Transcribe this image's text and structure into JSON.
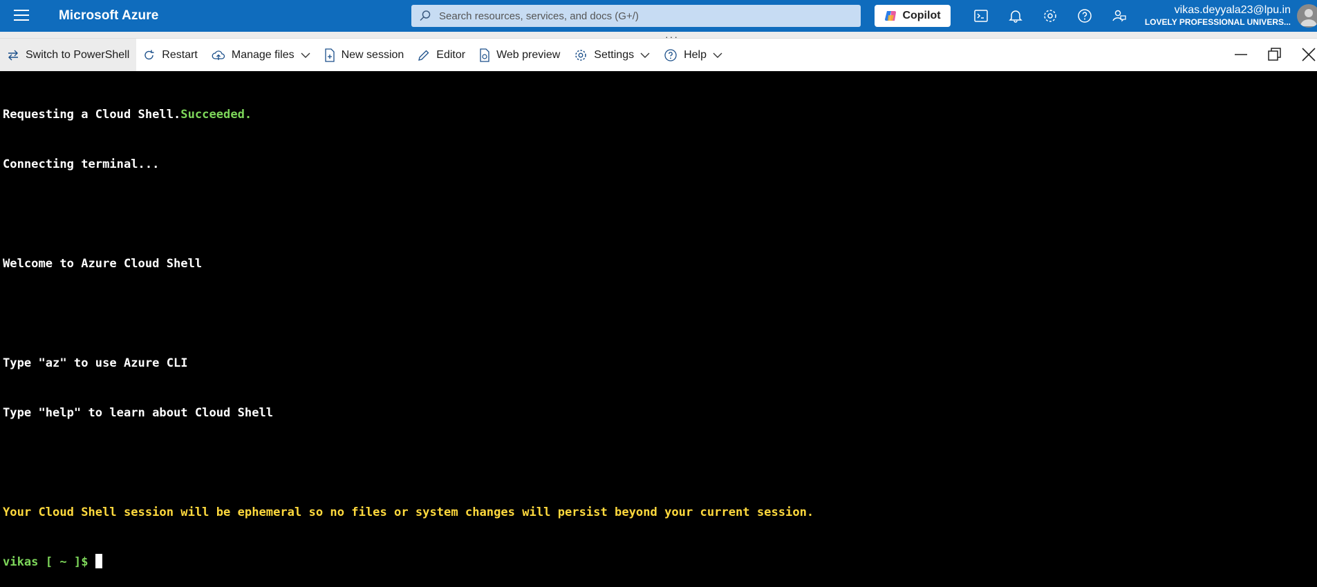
{
  "topbar": {
    "brand": "Microsoft Azure",
    "search_placeholder": "Search resources, services, and docs (G+/)",
    "copilot_label": "Copilot",
    "user_email": "vikas.deyyala23@lpu.in",
    "user_org": "LOVELY PROFESSIONAL UNIVERS..."
  },
  "toolbar": {
    "switch": "Switch to PowerShell",
    "restart": "Restart",
    "manage_files": "Manage files",
    "new_session": "New session",
    "editor": "Editor",
    "web_preview": "Web preview",
    "settings": "Settings",
    "help": "Help"
  },
  "terminal": {
    "l1a": "Requesting a Cloud Shell.",
    "l1b": "Succeeded.",
    "l2": "Connecting terminal...",
    "l3": "Welcome to Azure Cloud Shell",
    "l4": "Type \"az\" to use Azure CLI",
    "l5": "Type \"help\" to learn about Cloud Shell",
    "l6": "Your Cloud Shell session will be ephemeral so no files or system changes will persist beyond your current session.",
    "prompt_user": "vikas",
    "prompt_path": " [ ~ ]$",
    "prompt_rest": " "
  },
  "colors": {
    "azure_blue": "#0f6cbd",
    "success_green": "#7dd65a",
    "warning_yellow": "#ffd93d"
  }
}
